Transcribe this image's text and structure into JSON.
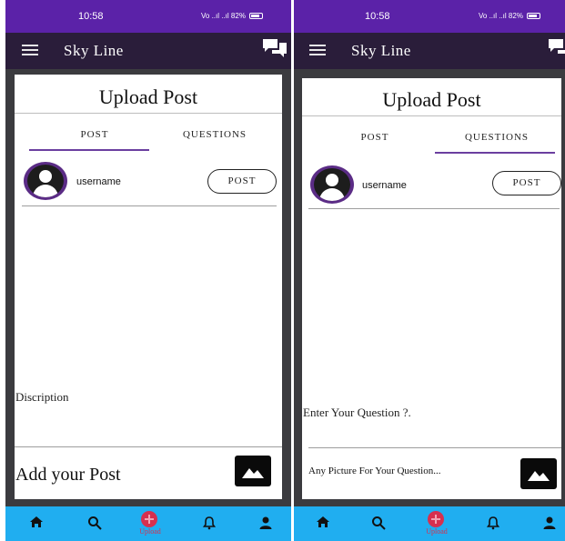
{
  "status_bar": {
    "time": "10:58",
    "network_text": "Vo ..ıl ..ıl",
    "battery_text": "82%"
  },
  "app_bar": {
    "title": "Sky Line",
    "menu_icon": "hamburger-menu-icon",
    "chat_icon": "chat-bubbles-icon"
  },
  "screens": [
    {
      "title": "Upload Post",
      "tabs": [
        {
          "label": "POST",
          "active": true
        },
        {
          "label": "QUESTIONS",
          "active": false
        }
      ],
      "username": "username",
      "post_button": "POST",
      "description_placeholder": "Discription",
      "add_placeholder": "Add your Post",
      "image_icon": "image-icon"
    },
    {
      "title": "Upload Post",
      "tabs": [
        {
          "label": "POST",
          "active": false
        },
        {
          "label": "QUESTIONS",
          "active": true
        }
      ],
      "username": "username",
      "post_button": "POST",
      "description_placeholder": "Enter Your Question ?.",
      "add_placeholder": "Any Picture For Your Question...",
      "image_icon": "image-icon"
    }
  ],
  "bottom_nav": {
    "items": [
      {
        "icon": "home-icon"
      },
      {
        "icon": "search-icon"
      },
      {
        "icon": "upload-icon",
        "label": "Upload"
      },
      {
        "icon": "bell-icon"
      },
      {
        "icon": "person-icon"
      }
    ]
  },
  "colors": {
    "status_bar": "#5b22a8",
    "app_bar": "#2a1d3a",
    "bottom_nav": "#20aef0",
    "upload_accent": "#d6304f",
    "tab_indicator": "#6b3fa0"
  }
}
